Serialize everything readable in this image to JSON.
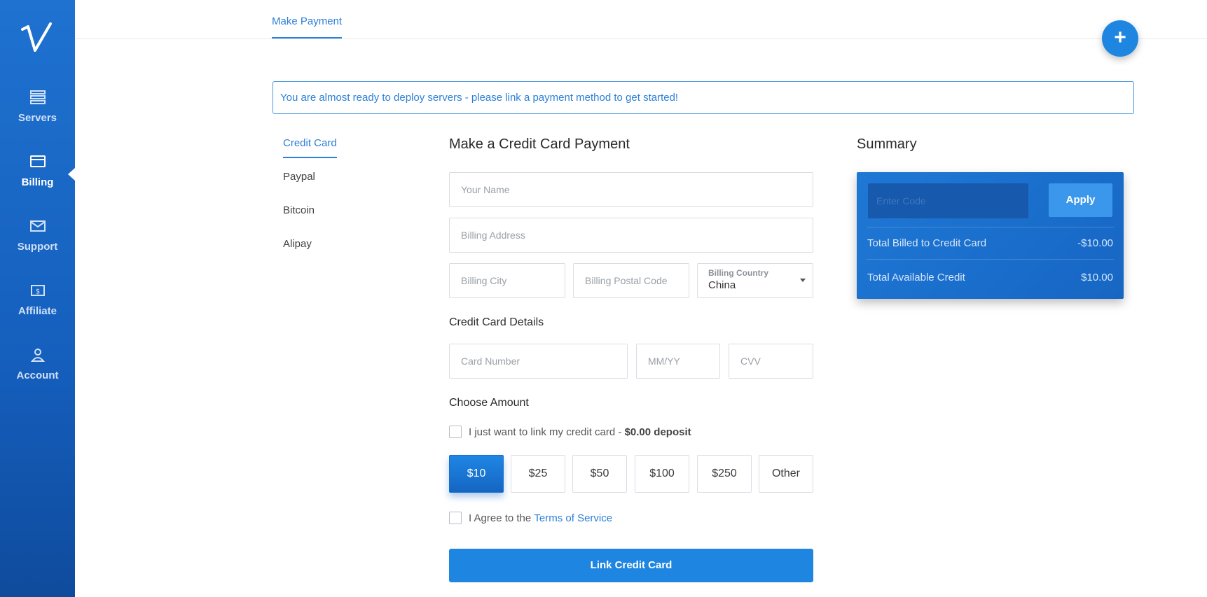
{
  "sidebar": {
    "items": [
      {
        "label": "Servers",
        "icon": "servers-icon"
      },
      {
        "label": "Billing",
        "icon": "credit-card-icon"
      },
      {
        "label": "Support",
        "icon": "envelope-icon"
      },
      {
        "label": "Affiliate",
        "icon": "dollar-bill-icon"
      },
      {
        "label": "Account",
        "icon": "user-icon"
      }
    ],
    "active": "Billing"
  },
  "header": {
    "tab": "Make Payment",
    "fab_label": "+"
  },
  "alert": {
    "text": "You are almost ready to deploy servers - please link a payment method to get started!"
  },
  "methods": [
    "Credit Card",
    "Paypal",
    "Bitcoin",
    "Alipay"
  ],
  "form": {
    "title": "Make a Credit Card Payment",
    "name_placeholder": "Your Name",
    "address_placeholder": "Billing Address",
    "city_placeholder": "Billing City",
    "postal_placeholder": "Billing Postal Code",
    "country_label": "Billing Country",
    "country_value": "China",
    "card_section": "Credit Card Details",
    "card_number_placeholder": "Card Number",
    "expiry_placeholder": "MM/YY",
    "cvv_placeholder": "CVV",
    "amount_section": "Choose Amount",
    "link_only_text": "I just want to link my credit card - ",
    "link_only_bold": "$0.00 deposit",
    "amounts": [
      "$10",
      "$25",
      "$50",
      "$100",
      "$250",
      "Other"
    ],
    "selected_amount": "$10",
    "agree_text": "I Agree to the ",
    "agree_link": "Terms of Service",
    "submit_label": "Link Credit Card"
  },
  "summary": {
    "title": "Summary",
    "code_placeholder": "Enter Code",
    "apply_label": "Apply",
    "rows": [
      {
        "label": "Total Billed to Credit Card",
        "value": "-$10.00"
      },
      {
        "label": "Total Available Credit",
        "value": "$10.00"
      }
    ]
  },
  "colors": {
    "accent": "#1e86e0",
    "sidebar": "#155fbd"
  }
}
